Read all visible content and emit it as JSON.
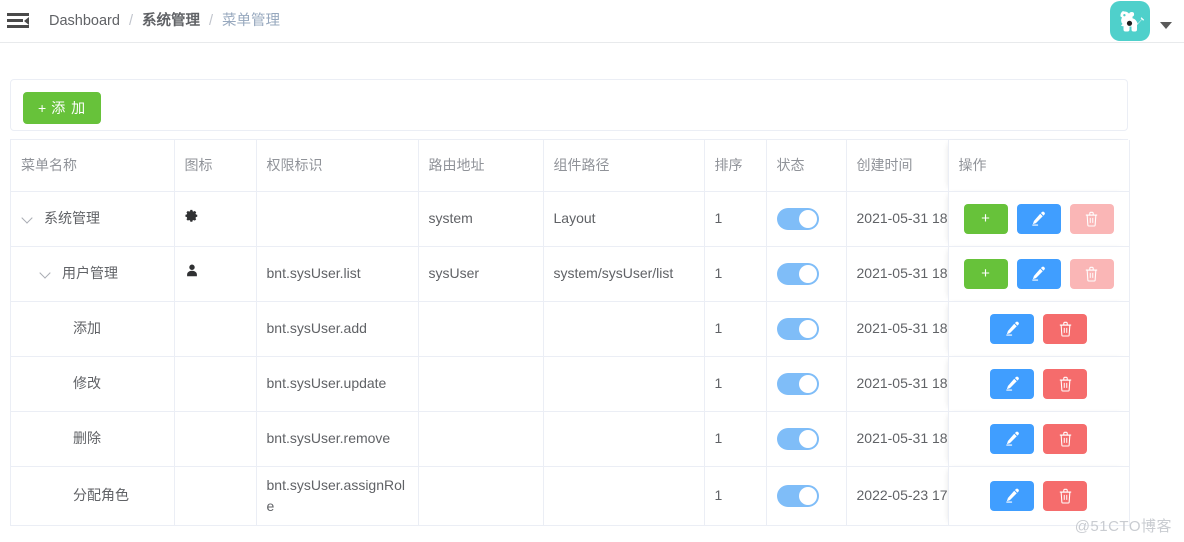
{
  "navbar": {
    "menu_icon": "hamburger-collapse-icon",
    "breadcrumb": {
      "item1": "Dashboard",
      "sep1": "/",
      "item2": "系统管理",
      "sep2": "/",
      "item3": "菜单管理"
    },
    "avatar": {
      "icon": "user-avatar-cartoon",
      "background": "#4fd0cb"
    },
    "caret_icon": "chevron-down-icon"
  },
  "toolbar": {
    "add_label": "添 加",
    "add_plus": "+",
    "add_color": "#67c23a"
  },
  "table": {
    "headers": {
      "name": "菜单名称",
      "icon": "图标",
      "perm": "权限标识",
      "route": "路由地址",
      "component": "组件路径",
      "sort": "排序",
      "status": "状态",
      "created": "创建时间",
      "operation": "操作"
    },
    "rows": [
      {
        "level": 0,
        "expandable": true,
        "name": "系统管理",
        "icon_glyph": "✿",
        "icon_name": "gear-icon",
        "perm": "",
        "route": "system",
        "component": "Layout",
        "sort": "1",
        "status_on": true,
        "created": "2021-05-31 18",
        "ops": [
          "add",
          "edit",
          "delete-disabled"
        ]
      },
      {
        "level": 1,
        "expandable": true,
        "name": "用户管理",
        "icon_glyph": "",
        "icon_name": "user-icon",
        "perm": "bnt.sysUser.list",
        "route": "sysUser",
        "component": "system/sysUser/list",
        "sort": "1",
        "status_on": true,
        "created": "2021-05-31 18",
        "ops": [
          "add",
          "edit",
          "delete-disabled"
        ]
      },
      {
        "level": 2,
        "expandable": false,
        "name": "添加",
        "icon_glyph": "",
        "icon_name": "",
        "perm": "bnt.sysUser.add",
        "route": "",
        "component": "",
        "sort": "1",
        "status_on": true,
        "created": "2021-05-31 18",
        "ops": [
          "edit",
          "delete"
        ]
      },
      {
        "level": 2,
        "expandable": false,
        "name": "修改",
        "icon_glyph": "",
        "icon_name": "",
        "perm": "bnt.sysUser.update",
        "route": "",
        "component": "",
        "sort": "1",
        "status_on": true,
        "created": "2021-05-31 18",
        "ops": [
          "edit",
          "delete"
        ]
      },
      {
        "level": 2,
        "expandable": false,
        "name": "删除",
        "icon_glyph": "",
        "icon_name": "",
        "perm": "bnt.sysUser.remove",
        "route": "",
        "component": "",
        "sort": "1",
        "status_on": true,
        "created": "2021-05-31 18",
        "ops": [
          "edit",
          "delete"
        ]
      },
      {
        "level": 2,
        "expandable": false,
        "name": "分配角色",
        "icon_glyph": "",
        "icon_name": "",
        "perm": "bnt.sysUser.assignRole",
        "route": "",
        "component": "",
        "sort": "1",
        "status_on": true,
        "created": "2022-05-23 17",
        "ops": [
          "edit",
          "delete"
        ]
      }
    ]
  },
  "watermark": "@51CTO博客"
}
